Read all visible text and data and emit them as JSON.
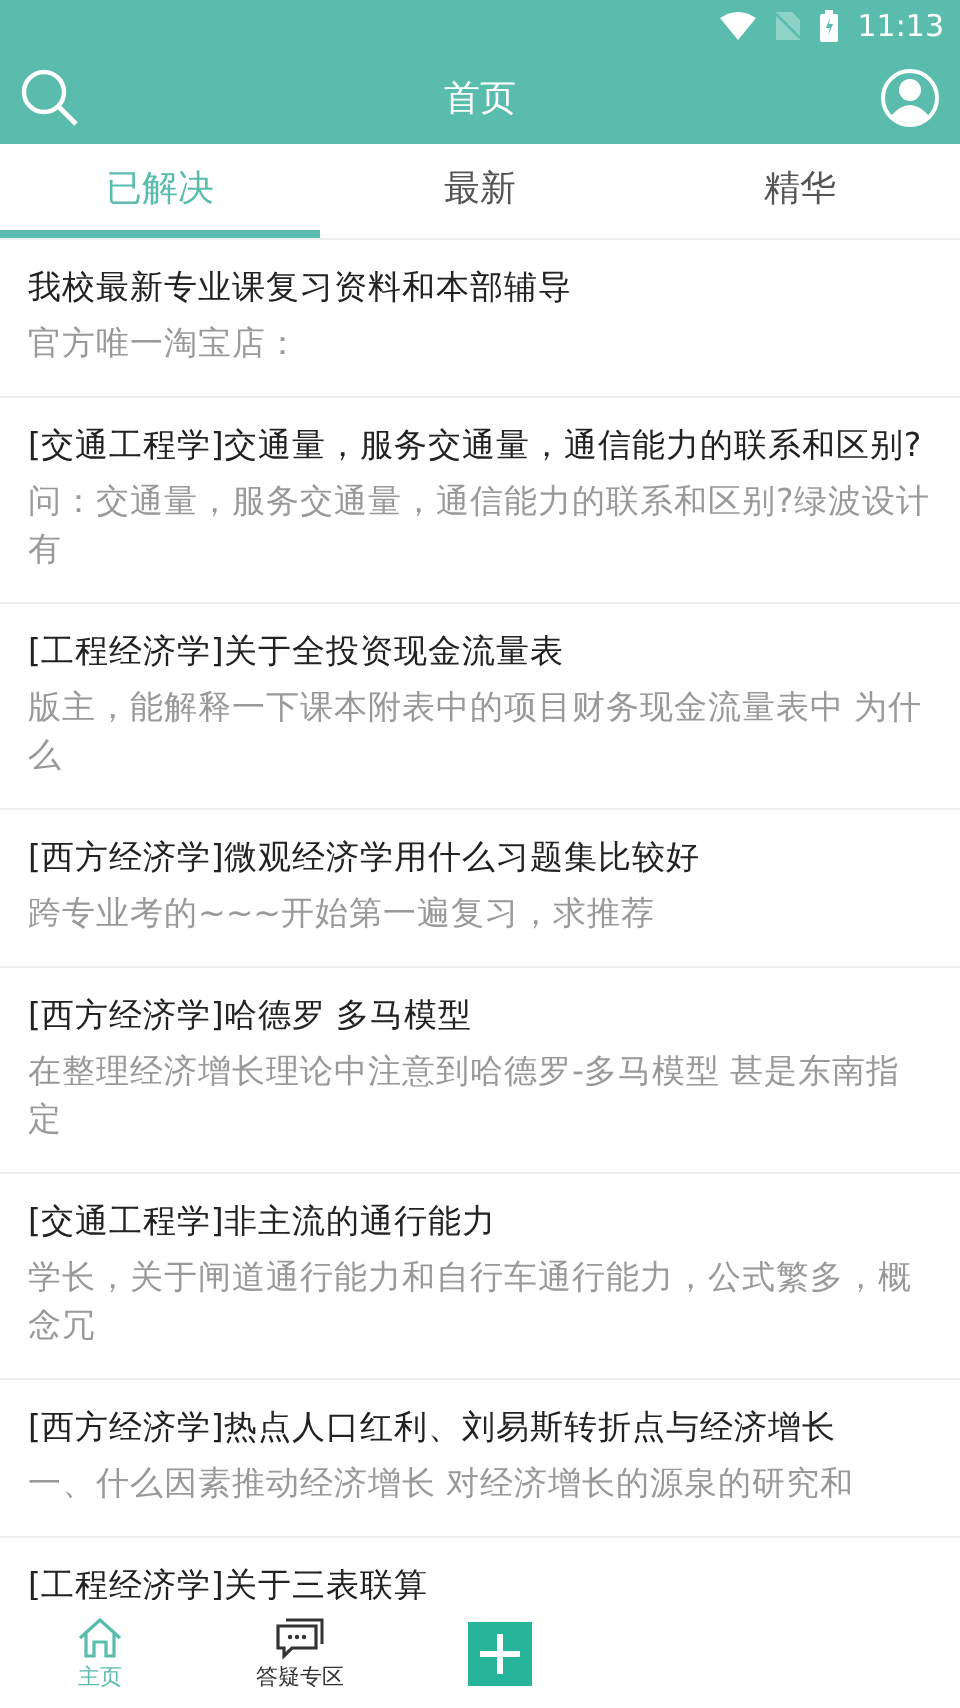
{
  "status_bar": {
    "time": "11:13"
  },
  "header": {
    "title": "首页"
  },
  "tabs": [
    {
      "label": "已解决",
      "selected": true
    },
    {
      "label": "最新",
      "selected": false
    },
    {
      "label": "精华",
      "selected": false
    }
  ],
  "posts": [
    {
      "title": "我校最新专业课复习资料和本部辅导",
      "excerpt": "官方唯一淘宝店："
    },
    {
      "title": "[交通工程学]交通量，服务交通量，通信能力的联系和区别?",
      "excerpt": "问：交通量，服务交通量，通信能力的联系和区别?绿波设计有"
    },
    {
      "title": "[工程经济学]关于全投资现金流量表",
      "excerpt": "版主，能解释一下课本附表中的项目财务现金流量表中 为什么"
    },
    {
      "title": "[西方经济学]微观经济学用什么习题集比较好",
      "excerpt": "跨专业考的~~~开始第一遍复习，求推荐"
    },
    {
      "title": "[西方经济学]哈德罗 多马模型",
      "excerpt": "在整理经济增长理论中注意到哈德罗-多马模型 甚是东南指定"
    },
    {
      "title": "[交通工程学]非主流的通行能力",
      "excerpt": "学长，关于闸道通行能力和自行车通行能力，公式繁多，概念冗"
    },
    {
      "title": "[西方经济学]热点人口红利、刘易斯转折点与经济增长",
      "excerpt": "一、什么因素推动经济增长   对经济增长的源泉的研究和"
    },
    {
      "title": "[工程经济学]关于三表联算"
    }
  ],
  "bottom_nav": [
    {
      "kind": "home",
      "label": "主页",
      "selected": true
    },
    {
      "kind": "chat",
      "label": "答疑专区",
      "selected": false
    },
    {
      "kind": "add"
    }
  ]
}
